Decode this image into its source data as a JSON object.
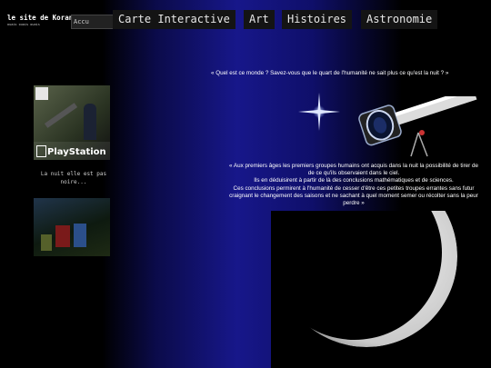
{
  "header": {
    "site_title": "le site de Koranta",
    "site_subtitle": "ouais ouais ouais",
    "home_tab": "Accu"
  },
  "nav": {
    "items": [
      {
        "label": "Carte Interactive"
      },
      {
        "label": "Art"
      },
      {
        "label": "Histoires"
      },
      {
        "label": "Astronomie"
      }
    ]
  },
  "sidebar": {
    "playstation_logo": "PlayStation",
    "caption": "La nuit elle est pas noire..."
  },
  "main": {
    "quote": "« Quel est ce monde ? Savez-vous que le quart de l'humanité ne sait plus ce qu'est la nuit ? »",
    "body_lines": [
      "« Aux premiers âges les premiers groupes humains ont acquis dans la nuit la possibilité de tirer de",
      "de ce qu'ils observaient dans le ciel.",
      "Ils en déduisirent à partir de là des conclusions mathématiques et de sciences.",
      "Ces conclusions permirent à l'humanité de cesser d'être ces petites troupes errantes sans futur",
      "craignant le changement des saisons et ne sachant à quel moment semer ou récolter sans la peur",
      "perdre »"
    ]
  },
  "colors": {
    "background": "#000000",
    "gradient_center": "#17178a",
    "nav_bg": "#141414"
  }
}
